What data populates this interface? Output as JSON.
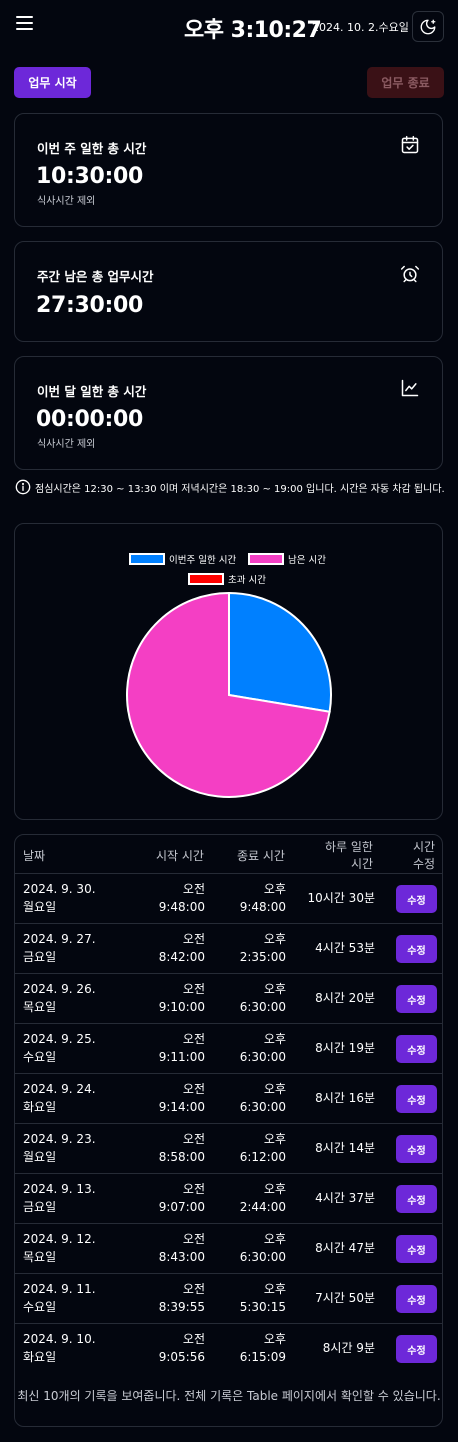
{
  "header": {
    "clock": "오후 3:10:27",
    "date": "2024. 10. 2.수요일"
  },
  "actions": {
    "start_label": "업무 시작",
    "end_label": "업무 종료"
  },
  "cards": [
    {
      "title": "이번 주 일한 총 시간",
      "value": "10:30:00",
      "sub": "식사시간 제외",
      "icon": "calendar-check-icon"
    },
    {
      "title": "주간 남은 총 업무시간",
      "value": "27:30:00",
      "sub": "",
      "icon": "alarm-clock-icon"
    },
    {
      "title": "이번 달 일한 총 시간",
      "value": "00:00:00",
      "sub": "식사시간 제외",
      "icon": "line-chart-icon"
    }
  ],
  "notice": "점심시간은 12:30 ~ 13:30 이며 저녁시간은 18:30 ~ 19:00 입니다. 시간은 자동 차감 됩니다.",
  "chart_data": {
    "type": "pie",
    "labels": [
      "이번주 일한 시간",
      "남은 시간",
      "초과 시간"
    ],
    "values": [
      10.5,
      27.5,
      0
    ],
    "colors": [
      "#0080ff",
      "#f43fc4",
      "#ff0000"
    ],
    "legend_position": "top"
  },
  "table": {
    "headers": {
      "date": "날짜",
      "start": "시작 시간",
      "end": "종료 시간",
      "worked_line1": "하루 일한",
      "worked_line2": "시간",
      "edit_line1": "시간",
      "edit_line2": "수정"
    },
    "edit_label": "수정",
    "rows": [
      {
        "date": "2024. 9. 30.",
        "weekday": "월요일",
        "start_ampm": "오전",
        "start_time": "9:48:00",
        "end_ampm": "오후",
        "end_time": "9:48:00",
        "worked": "10시간 30분"
      },
      {
        "date": "2024. 9. 27.",
        "weekday": "금요일",
        "start_ampm": "오전",
        "start_time": "8:42:00",
        "end_ampm": "오후",
        "end_time": "2:35:00",
        "worked": "4시간 53분"
      },
      {
        "date": "2024. 9. 26.",
        "weekday": "목요일",
        "start_ampm": "오전",
        "start_time": "9:10:00",
        "end_ampm": "오후",
        "end_time": "6:30:00",
        "worked": "8시간 20분"
      },
      {
        "date": "2024. 9. 25.",
        "weekday": "수요일",
        "start_ampm": "오전",
        "start_time": "9:11:00",
        "end_ampm": "오후",
        "end_time": "6:30:00",
        "worked": "8시간 19분"
      },
      {
        "date": "2024. 9. 24.",
        "weekday": "화요일",
        "start_ampm": "오전",
        "start_time": "9:14:00",
        "end_ampm": "오후",
        "end_time": "6:30:00",
        "worked": "8시간 16분"
      },
      {
        "date": "2024. 9. 23.",
        "weekday": "월요일",
        "start_ampm": "오전",
        "start_time": "8:58:00",
        "end_ampm": "오후",
        "end_time": "6:12:00",
        "worked": "8시간 14분"
      },
      {
        "date": "2024. 9. 13.",
        "weekday": "금요일",
        "start_ampm": "오전",
        "start_time": "9:07:00",
        "end_ampm": "오후",
        "end_time": "2:44:00",
        "worked": "4시간 37분"
      },
      {
        "date": "2024. 9. 12.",
        "weekday": "목요일",
        "start_ampm": "오전",
        "start_time": "8:43:00",
        "end_ampm": "오후",
        "end_time": "6:30:00",
        "worked": "8시간 47분"
      },
      {
        "date": "2024. 9. 11.",
        "weekday": "수요일",
        "start_ampm": "오전",
        "start_time": "8:39:55",
        "end_ampm": "오후",
        "end_time": "5:30:15",
        "worked": "7시간 50분"
      },
      {
        "date": "2024. 9. 10.",
        "weekday": "화요일",
        "start_ampm": "오전",
        "start_time": "9:05:56",
        "end_ampm": "오후",
        "end_time": "6:15:09",
        "worked": "8시간 9분"
      }
    ],
    "footer": "최신 10개의 기록을 보여줍니다. 전체 기록은 Table 페이지에서 확인할 수 있습니다."
  }
}
